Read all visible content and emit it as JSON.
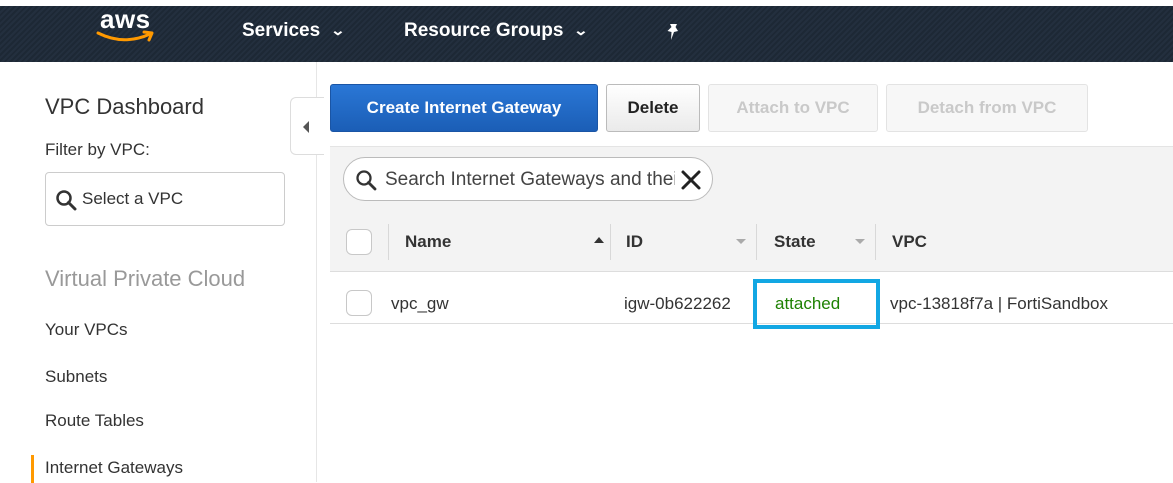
{
  "topnav": {
    "logo_text": "aws",
    "services_label": "Services",
    "resource_groups_label": "Resource Groups",
    "chevron_glyph": "⌄"
  },
  "sidebar": {
    "title": "VPC Dashboard",
    "filter_label": "Filter by VPC:",
    "vpc_select_placeholder": "Select a VPC",
    "section_heading": "Virtual Private Cloud",
    "items": [
      {
        "label": "Your VPCs"
      },
      {
        "label": "Subnets"
      },
      {
        "label": "Route Tables"
      },
      {
        "label": "Internet Gateways",
        "active": true
      }
    ]
  },
  "toolbar": {
    "create_label": "Create Internet Gateway",
    "delete_label": "Delete",
    "attach_label": "Attach to VPC",
    "detach_label": "Detach from VPC"
  },
  "search": {
    "placeholder": "Search Internet Gateways and their properties"
  },
  "table": {
    "columns": [
      {
        "label": "Name"
      },
      {
        "label": "ID"
      },
      {
        "label": "State"
      },
      {
        "label": "VPC"
      }
    ],
    "rows": [
      {
        "name": "vpc_gw",
        "id": "igw-0b622262",
        "state": "attached",
        "vpc": "vpc-13818f7a | FortiSandbox"
      }
    ]
  },
  "colors": {
    "primary_button": "#1b5eb6",
    "nav_bg": "#232f3e",
    "active_accent": "#ff9900",
    "state_attached": "#1d8102",
    "highlight_box": "#12a7e3"
  }
}
